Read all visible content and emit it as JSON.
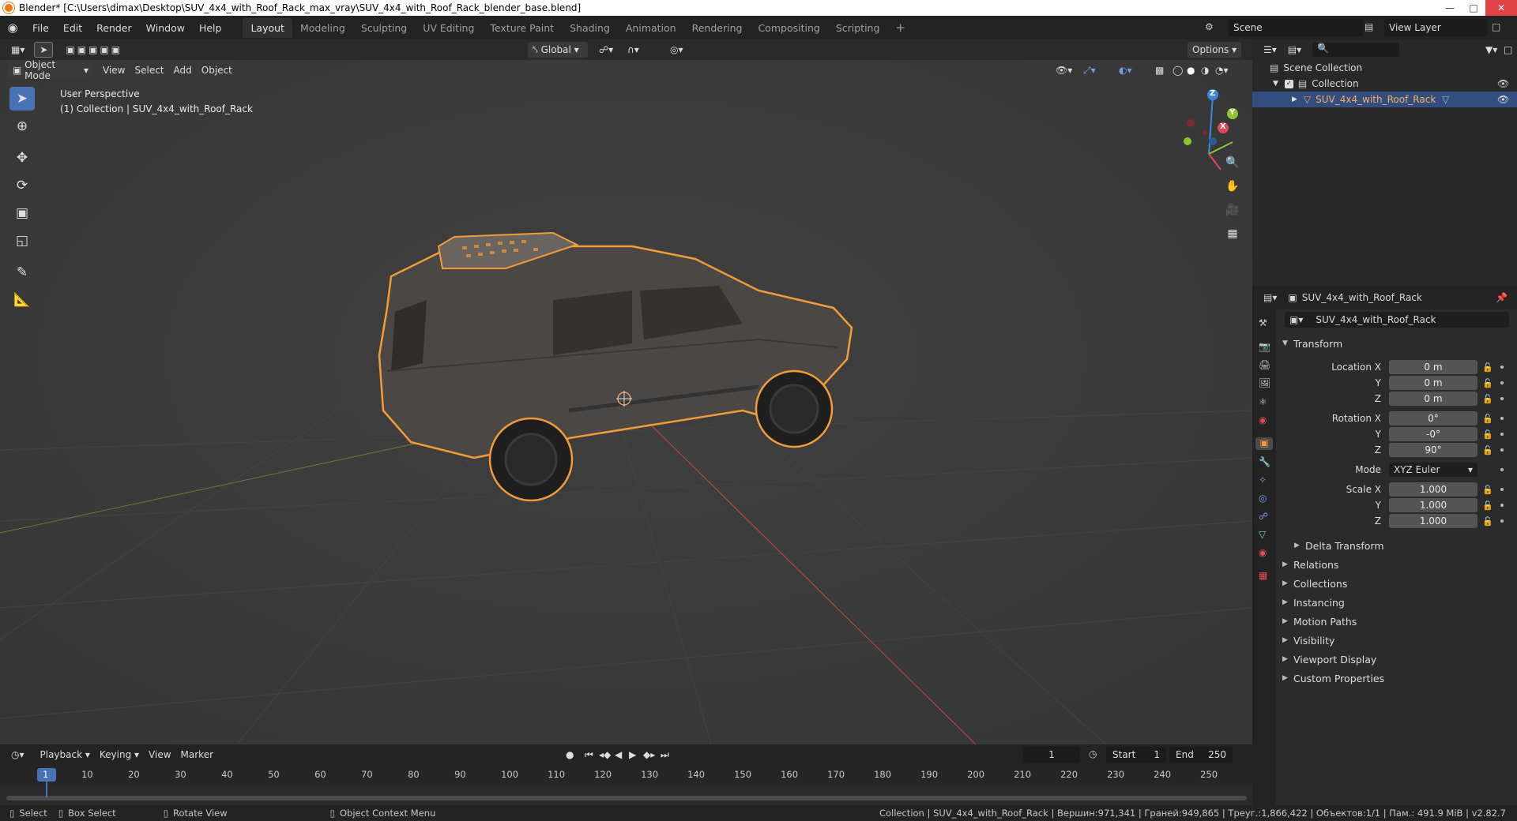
{
  "title": "Blender* [C:\\Users\\dimax\\Desktop\\SUV_4x4_with_Roof_Rack_max_vray\\SUV_4x4_with_Roof_Rack_blender_base.blend]",
  "menu": [
    "File",
    "Edit",
    "Render",
    "Window",
    "Help"
  ],
  "workspaces": [
    "Layout",
    "Modeling",
    "Sculpting",
    "UV Editing",
    "Texture Paint",
    "Shading",
    "Animation",
    "Rendering",
    "Compositing",
    "Scripting"
  ],
  "scene": "Scene",
  "view_layer": "View Layer",
  "viewport": {
    "transform_orientation": "Global",
    "options": "Options",
    "mode": "Object Mode",
    "menus": [
      "View",
      "Select",
      "Add",
      "Object"
    ],
    "info_line1": "User Perspective",
    "info_line2": "(1) Collection | SUV_4x4_with_Roof_Rack",
    "gizmo": {
      "z": "Z",
      "y": "Y",
      "x": "X"
    }
  },
  "outliner": {
    "scene_collection": "Scene Collection",
    "collection": "Collection",
    "object": "SUV_4x4_with_Roof_Rack"
  },
  "properties": {
    "header_object": "SUV_4x4_with_Roof_Rack",
    "object_name": "SUV_4x4_with_Roof_Rack",
    "transform_label": "Transform",
    "location": {
      "label": "Location X",
      "x": "0 m",
      "y": "0 m",
      "z": "0 m"
    },
    "rotation": {
      "label": "Rotation X",
      "x": "0°",
      "y": "-0°",
      "z": "90°"
    },
    "mode_label": "Mode",
    "mode_value": "XYZ Euler",
    "scale": {
      "label": "Scale X",
      "x": "1.000",
      "y": "1.000",
      "z": "1.000"
    },
    "axis_y": "Y",
    "axis_z": "Z",
    "delta": "Delta Transform",
    "panels": [
      "Relations",
      "Collections",
      "Instancing",
      "Motion Paths",
      "Visibility",
      "Viewport Display",
      "Custom Properties"
    ]
  },
  "timeline": {
    "menus": [
      "Playback",
      "Keying",
      "View",
      "Marker"
    ],
    "current_frame": "1",
    "start_label": "Start",
    "start": "1",
    "end_label": "End",
    "end": "250",
    "ticks": [
      "1",
      "10",
      "20",
      "30",
      "40",
      "50",
      "60",
      "70",
      "80",
      "90",
      "100",
      "110",
      "120",
      "130",
      "140",
      "150",
      "160",
      "170",
      "180",
      "190",
      "200",
      "210",
      "220",
      "230",
      "240",
      "250"
    ]
  },
  "status": {
    "select": "Select",
    "box_select": "Box Select",
    "rotate_view": "Rotate View",
    "context_menu": "Object Context Menu",
    "stats": "Collection | SUV_4x4_with_Roof_Rack | Вершин:971,341 | Граней:949,865 | Треуг.:1,866,422 | Объектов:1/1 | Пам.: 491.9 MiB | v2.82.7"
  },
  "colors": {
    "accent": "#4772b3",
    "selection": "#f29c38",
    "x_axis": "#e0475a",
    "y_axis": "#8ec52e",
    "z_axis": "#3d87de"
  }
}
